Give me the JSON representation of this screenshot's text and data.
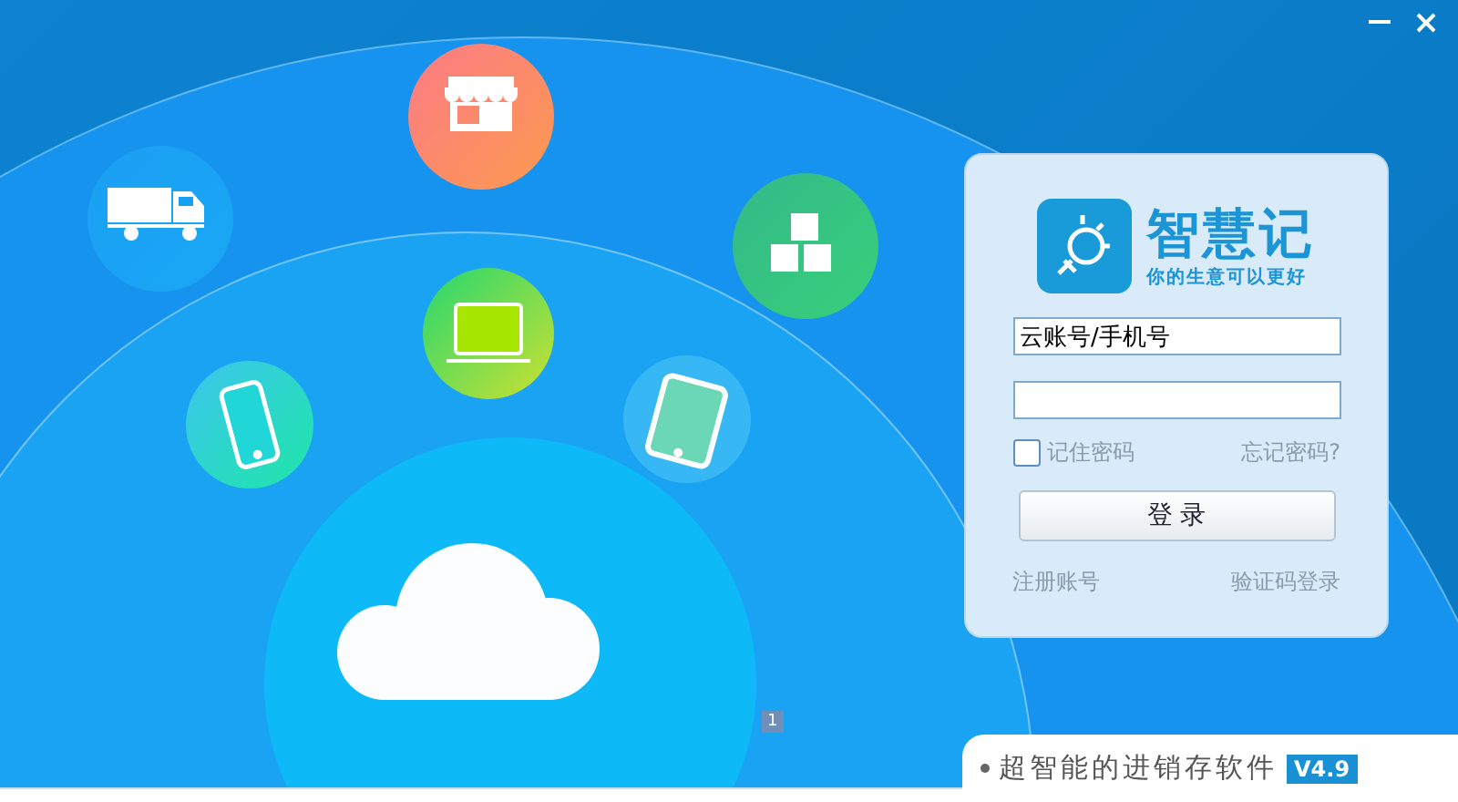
{
  "logo": {
    "name": "智慧记",
    "slogan": "你的生意可以更好"
  },
  "login": {
    "account": {
      "value": "云账号/手机号"
    },
    "remember": {
      "label": "记住密码",
      "checked": false
    },
    "forgot": "忘记密码?",
    "submit": "登 录",
    "register": "注册账号",
    "code_login": "验证码登录"
  },
  "page_badge": "1",
  "footer": {
    "tagline": "超智能的进销存软件",
    "version": "V4.9"
  }
}
